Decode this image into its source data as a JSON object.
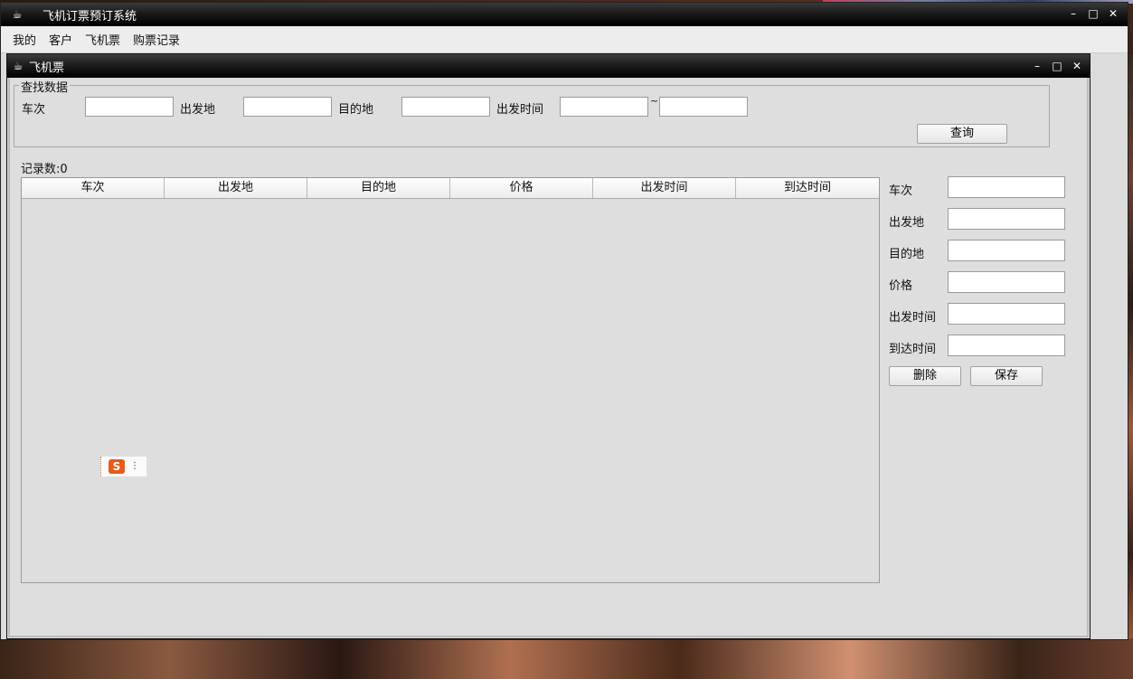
{
  "window": {
    "title": "飞机订票预订系统",
    "controls": {
      "minimize": "–",
      "maximize": "□",
      "close": "✕"
    }
  },
  "menubar": {
    "items": [
      "我的",
      "客户",
      "飞机票",
      "购票记录"
    ]
  },
  "inner_window": {
    "title": "飞机票",
    "controls": {
      "minimize": "–",
      "maximize": "□",
      "close": "✕"
    }
  },
  "search": {
    "legend": "查找数据",
    "flight_no_label": "车次",
    "flight_no_value": "",
    "departure_label": "出发地",
    "departure_value": "",
    "destination_label": "目的地",
    "destination_value": "",
    "depart_time_label": "出发时间",
    "depart_time_from": "",
    "range_sep": "~",
    "depart_time_to": "",
    "query_button": "查询"
  },
  "records": {
    "count_label": "记录数:0"
  },
  "table": {
    "columns": [
      "车次",
      "出发地",
      "目的地",
      "价格",
      "出发时间",
      "到达时间"
    ],
    "rows": []
  },
  "ime": {
    "logo": "S",
    "menu": "⋮"
  },
  "edit": {
    "fields": [
      {
        "label": "车次",
        "value": ""
      },
      {
        "label": "出发地",
        "value": ""
      },
      {
        "label": "目的地",
        "value": ""
      },
      {
        "label": "价格",
        "value": ""
      },
      {
        "label": "出发时间",
        "value": ""
      },
      {
        "label": "到达时间",
        "value": ""
      }
    ],
    "delete_button": "删除",
    "save_button": "保存"
  }
}
